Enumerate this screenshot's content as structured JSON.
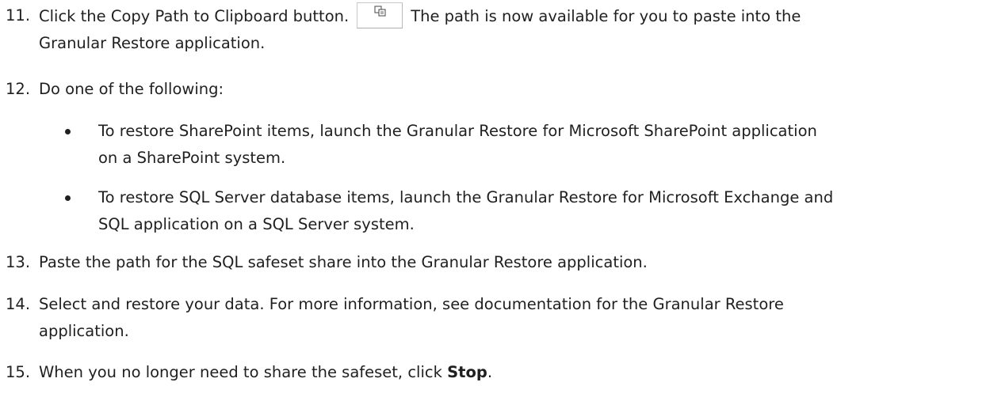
{
  "steps": [
    {
      "number": "11.",
      "text_before": "Click the Copy Path to Clipboard button.",
      "button_icon": "copy-clipboard-icon",
      "text_after": "The path is now available for you to paste into the",
      "line2": "Granular Restore application."
    },
    {
      "number": "12.",
      "line1": "Do one of the following:"
    },
    {
      "number": "13.",
      "line1": "Paste the path for the SQL safeset share into the Granular Restore application."
    },
    {
      "number": "14.",
      "line1": "Select and restore your data. For more information, see documentation for the Granular Restore",
      "line2": "application."
    },
    {
      "number": "15.",
      "text_before": "When you no longer need to share the safeset, click ",
      "bold": "Stop",
      "text_after": "."
    }
  ],
  "bullets": [
    {
      "line1": "To restore SharePoint items, launch the Granular Restore for Microsoft SharePoint application",
      "line2": "on a SharePoint system."
    },
    {
      "line1": "To restore SQL Server database items, launch the Granular Restore for Microsoft Exchange and",
      "line2": "SQL application on a SQL Server system."
    }
  ]
}
